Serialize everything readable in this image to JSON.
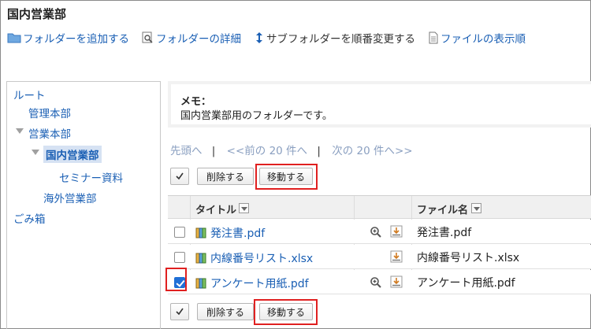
{
  "page": {
    "title": "国内営業部"
  },
  "toolbar": {
    "add_folder": "フォルダーを追加する",
    "folder_details": "フォルダーの詳細",
    "reorder_subfolders": "サブフォルダーを順番変更する",
    "file_display_order": "ファイルの表示順"
  },
  "sidebar": {
    "root": "ルート",
    "items": [
      {
        "label": "管理本部"
      },
      {
        "label": "営業本部"
      },
      {
        "label": "国内営業部"
      },
      {
        "label": "セミナー資料"
      },
      {
        "label": "海外営業部"
      },
      {
        "label": "ごみ箱"
      }
    ]
  },
  "memo": {
    "label": "メモ：",
    "text": "国内営業部用のフォルダーです。"
  },
  "pager": {
    "first": "先頭へ",
    "sep": "|",
    "prev": "<<前の 20 件へ",
    "next": "次の 20 件へ>>"
  },
  "actions": {
    "delete": "削除する",
    "move": "移動する"
  },
  "table": {
    "headers": {
      "title": "タイトル",
      "filename": "ファイル名"
    },
    "rows": [
      {
        "title": "発注書.pdf",
        "filename": "発注書.pdf",
        "checked": false,
        "has_preview": true
      },
      {
        "title": "内線番号リスト.xlsx",
        "filename": "内線番号リスト.xlsx",
        "checked": false,
        "has_preview": false
      },
      {
        "title": "アンケート用紙.pdf",
        "filename": "アンケート用紙.pdf",
        "checked": true,
        "has_preview": true
      }
    ]
  },
  "colors": {
    "link": "#1a5fb4",
    "highlight": "#e02020",
    "selected_bg": "#d6e2f3",
    "checkbox_checked": "#1f6fd6"
  },
  "icons": [
    "folder-icon",
    "folder-details-icon",
    "reorder-icon",
    "file-order-icon",
    "zoom-icon",
    "download-icon",
    "book-icon"
  ]
}
